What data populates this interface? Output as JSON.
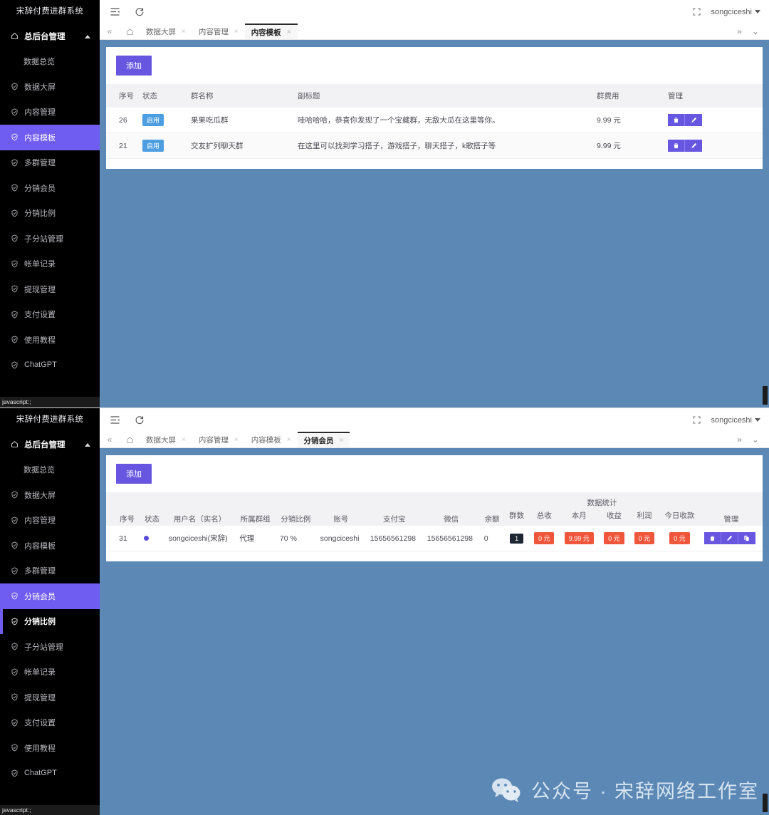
{
  "app": {
    "brand": "宋辞付费进群系统",
    "status_text": "javascript:;",
    "username": "songciceshi",
    "watermark": "公众号 · 宋辞网络工作室",
    "accent": "#6656e0",
    "sidebar_bg": "#000000",
    "content_bg": "#5b88b5"
  },
  "sidebar": {
    "items": [
      {
        "label": "总后台管理",
        "icon": "home-icon",
        "type": "group"
      },
      {
        "label": "数据总览",
        "icon": "none",
        "type": "child"
      },
      {
        "label": "数据大屏",
        "icon": "check-shield-icon",
        "type": "item"
      },
      {
        "label": "内容管理",
        "icon": "check-shield-icon",
        "type": "item"
      },
      {
        "label": "内容模板",
        "icon": "check-shield-icon",
        "type": "item"
      },
      {
        "label": "多群管理",
        "icon": "check-shield-icon",
        "type": "item"
      },
      {
        "label": "分销会员",
        "icon": "check-shield-icon",
        "type": "item"
      },
      {
        "label": "分销比例",
        "icon": "check-shield-icon",
        "type": "item"
      },
      {
        "label": "子分站管理",
        "icon": "check-shield-icon",
        "type": "item"
      },
      {
        "label": "帐单记录",
        "icon": "check-shield-icon",
        "type": "item"
      },
      {
        "label": "提现管理",
        "icon": "check-shield-icon",
        "type": "item"
      },
      {
        "label": "支付设置",
        "icon": "check-shield-icon",
        "type": "item"
      },
      {
        "label": "使用教程",
        "icon": "check-shield-icon",
        "type": "item"
      },
      {
        "label": "ChatGPT",
        "icon": "check-shield-icon",
        "type": "item"
      }
    ]
  },
  "panel1": {
    "tabs": [
      {
        "label": "数据大屏",
        "active": false
      },
      {
        "label": "内容管理",
        "active": false
      },
      {
        "label": "内容模板",
        "active": true
      }
    ],
    "active_sidebar": "内容模板",
    "hover_sidebar": "",
    "add_label": "添加",
    "table": {
      "columns": [
        "序号",
        "状态",
        "群名称",
        "副标题",
        "群费用",
        "管理"
      ],
      "rows": [
        {
          "序号": "26",
          "状态": "启用",
          "群名称": "果果吃瓜群",
          "副标题": "哇哈哈哈，恭喜你发现了一个宝藏群，无敌大瓜在这里等你。",
          "群费用": "9.99 元"
        },
        {
          "序号": "21",
          "状态": "启用",
          "群名称": "交友扩列聊天群",
          "副标题": "在这里可以找到学习搭子，游戏搭子，聊天搭子，k歌搭子等",
          "群费用": "9.99 元"
        }
      ]
    }
  },
  "panel2": {
    "tabs": [
      {
        "label": "数据大屏",
        "active": false
      },
      {
        "label": "内容管理",
        "active": false
      },
      {
        "label": "内容模板",
        "active": false
      },
      {
        "label": "分销会员",
        "active": true
      }
    ],
    "active_sidebar": "分销会员",
    "hover_sidebar": "分销比例",
    "add_label": "添加",
    "table": {
      "group_header": "数据统计",
      "lead_columns": [
        "序号",
        "状态",
        "用户名（实名）",
        "所属群组",
        "分销比例",
        "账号",
        "支付宝",
        "微信",
        "余额"
      ],
      "stat_columns": [
        "群数",
        "总收",
        "本月",
        "收益",
        "利润",
        "今日收款"
      ],
      "manage_column": "管理",
      "rows": [
        {
          "序号": "31",
          "状态": "dot",
          "用户名（实名）": "songciceshi(宋辞)",
          "所属群组": "代理",
          "分销比例": "70 %",
          "账号": "songciceshi",
          "支付宝": "15656561298",
          "微信": "15656561298",
          "余额": "0",
          "群数": "1",
          "总收": "0 元",
          "本月": "9.99 元",
          "收益": "0 元",
          "利润": "0 元",
          "今日收款": "0 元"
        }
      ]
    }
  },
  "icons": {
    "menu": "menu-collapse-icon",
    "refresh": "refresh-icon",
    "fullscreen": "fullscreen-icon",
    "tab_prev": "chevron-double-left-icon",
    "tab_home": "home-outline-icon",
    "tab_next": "chevron-double-right-icon",
    "tab_more": "chevron-down-icon",
    "delete": "trash-icon",
    "edit": "pencil-icon",
    "copy": "copy-icon",
    "wechat": "wechat-icon"
  }
}
